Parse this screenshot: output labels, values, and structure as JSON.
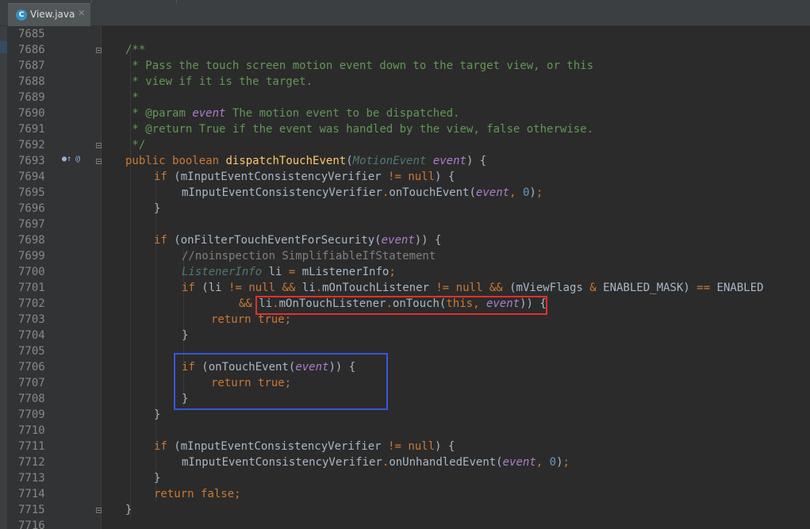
{
  "tab": {
    "icon_letter": "C",
    "title": "View.java",
    "close": "✕"
  },
  "gutter": {
    "lines": [
      "7685",
      "7686",
      "7687",
      "7688",
      "7689",
      "7690",
      "7691",
      "7692",
      "7693",
      "7694",
      "7695",
      "7696",
      "7697",
      "7698",
      "7699",
      "7700",
      "7701",
      "7702",
      "7703",
      "7704",
      "7705",
      "7706",
      "7707",
      "7708",
      "7709",
      "7710",
      "7711",
      "7712",
      "7713",
      "7714",
      "7715",
      "7716"
    ],
    "icons": [
      "override-marker-icon",
      "annotation-marker-icon"
    ]
  },
  "code": {
    "l7686": "/**",
    "l7687": " * Pass the touch screen motion event down to the target view, or this",
    "l7688": " * view if it is the target.",
    "l7689": " *",
    "l7690_a": " * ",
    "l7690_tag": "@param",
    "l7690_name": "event",
    "l7690_rest": " The motion event to be dispatched.",
    "l7691_a": " * ",
    "l7691_tag": "@return",
    "l7691_rest": " True if the event was handled by the view, false otherwise.",
    "l7692": " */",
    "kw_public": "public",
    "kw_boolean": "boolean",
    "kw_if": "if",
    "kw_null": "null",
    "kw_return": "return",
    "kw_true": "true",
    "kw_false": "false",
    "kw_this": "this",
    "fn_dispatch": "dispatchTouchEvent",
    "type_motion": "MotionEvent",
    "param_event": "event",
    "var_verifier": "mInputEventConsistencyVerifier",
    "method_onTouchEvent": "onTouchEvent",
    "method_onFilter": "onFilterTouchEventForSecurity",
    "comment_noinspection": "//noinspection SimplifiableIfStatement",
    "type_listener": "ListenerInfo",
    "var_li": "li",
    "var_mListenerInfo": "mListenerInfo",
    "field_mOnTouchListener": "mOnTouchListener",
    "var_mViewFlags": "mViewFlags",
    "const_enabled_mask": "ENABLED_MASK",
    "const_enabled": "ENABLED",
    "method_onTouch": "onTouch",
    "method_onUnhandled": "onUnhandledEvent",
    "num_zero": "0",
    "op_neq": "!=",
    "op_and": "&&",
    "op_eq": "==",
    "op_bitand": "&",
    "op_assign": "="
  }
}
